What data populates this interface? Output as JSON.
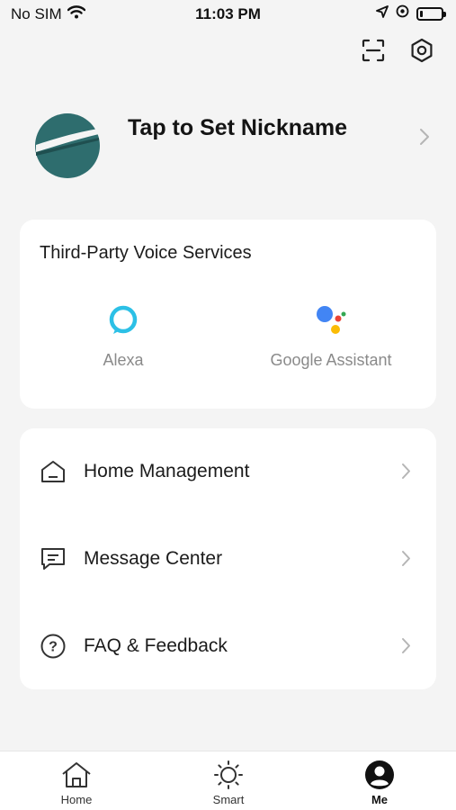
{
  "status_bar": {
    "carrier": "No SIM",
    "time": "11:03 PM",
    "battery_level": 0.12
  },
  "header": {
    "icons": [
      "scan-icon",
      "settings-icon"
    ]
  },
  "profile": {
    "nickname": "Tap to Set Nickname",
    "avatar_color": "#2e6d6e"
  },
  "voice_services": {
    "title": "Third-Party Voice Services",
    "items": [
      {
        "label": "Alexa",
        "icon": "alexa-icon",
        "color": "#2cc0e6"
      },
      {
        "label": "Google Assistant",
        "icon": "google-assistant-icon"
      }
    ]
  },
  "menu": {
    "items": [
      {
        "label": "Home Management",
        "icon": "home-icon"
      },
      {
        "label": "Message Center",
        "icon": "message-icon"
      },
      {
        "label": "FAQ & Feedback",
        "icon": "help-icon"
      }
    ]
  },
  "tabs": [
    {
      "label": "Home",
      "icon": "home-tab-icon",
      "active": false
    },
    {
      "label": "Smart",
      "icon": "sun-icon",
      "active": false
    },
    {
      "label": "Me",
      "icon": "user-icon",
      "active": true
    }
  ],
  "colors": {
    "background": "#f4f4f4",
    "card": "#ffffff",
    "secondary_text": "#8a8a8a",
    "chevron": "#b5b5b5"
  }
}
